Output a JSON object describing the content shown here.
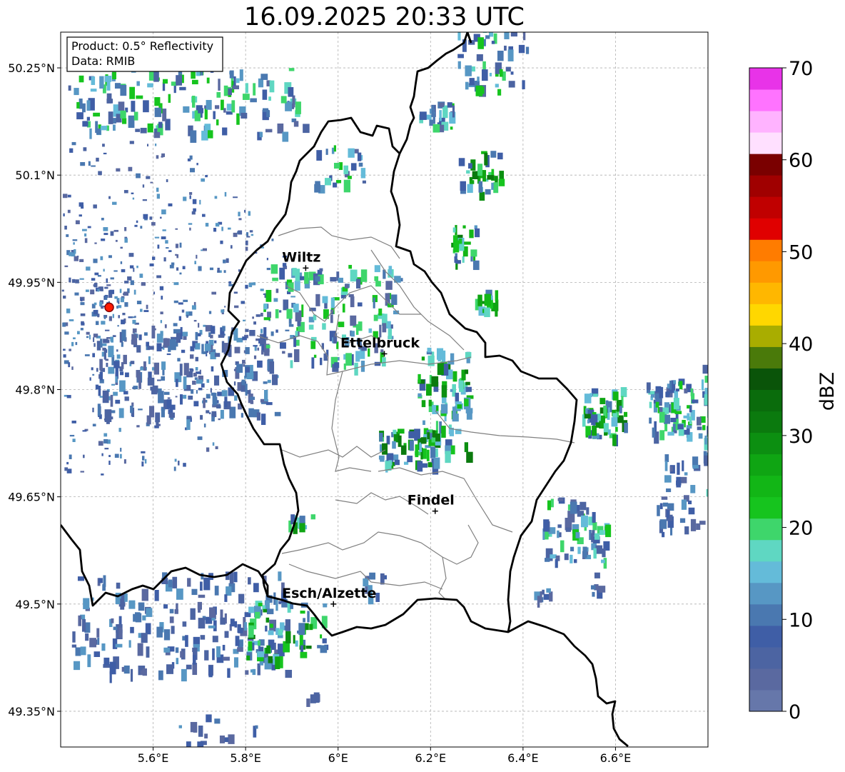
{
  "title": "16.09.2025 20:33 UTC",
  "info_box": {
    "product": "Product: 0.5° Reflectivity",
    "data": "Data: RMIB"
  },
  "lon_ticks": [
    {
      "value": 5.6,
      "label": "5.6°E"
    },
    {
      "value": 5.8,
      "label": "5.8°E"
    },
    {
      "value": 6.0,
      "label": "6°E"
    },
    {
      "value": 6.2,
      "label": "6.2°E"
    },
    {
      "value": 6.4,
      "label": "6.4°E"
    },
    {
      "value": 6.6,
      "label": "6.6°E"
    }
  ],
  "lat_ticks": [
    {
      "value": 50.25,
      "label": "50.25°N"
    },
    {
      "value": 50.1,
      "label": "50.1°N"
    },
    {
      "value": 49.95,
      "label": "49.95°N"
    },
    {
      "value": 49.8,
      "label": "49.8°N"
    },
    {
      "value": 49.65,
      "label": "49.65°N"
    },
    {
      "value": 49.5,
      "label": "49.5°N"
    },
    {
      "value": 49.35,
      "label": "49.35°N"
    }
  ],
  "extent": {
    "lon_min": 5.4,
    "lon_max": 6.8,
    "lat_min": 49.3,
    "lat_max": 50.3
  },
  "cities": [
    {
      "name": "Wiltz",
      "lon": 5.93,
      "lat": 49.97
    },
    {
      "name": "Ettelbruck",
      "lon": 6.1,
      "lat": 49.85
    },
    {
      "name": "Findel",
      "lon": 6.21,
      "lat": 49.63
    },
    {
      "name": "Esch/Alzette",
      "lon": 5.99,
      "lat": 49.5
    }
  ],
  "radar_site": {
    "lon": 5.505,
    "lat": 49.915,
    "color": "#ff1a00"
  },
  "colorbar": {
    "label": "dBZ",
    "min": 0,
    "max": 70,
    "ticks": [
      "0",
      "10",
      "20",
      "30",
      "40",
      "50",
      "60",
      "70"
    ],
    "colors": [
      "#6677aa",
      "#5a69a0",
      "#4c64a2",
      "#3f5ea6",
      "#4a78b0",
      "#5797c4",
      "#64bbd9",
      "#5fd7c2",
      "#3ed66b",
      "#16c41e",
      "#12b616",
      "#0fa513",
      "#0c8f11",
      "#0b7a0e",
      "#0a6c0c",
      "#0a5409",
      "#4a7a0a",
      "#a9ad00",
      "#ffd700",
      "#ffb700",
      "#ff9900",
      "#ff7c00",
      "#e00000",
      "#c00000",
      "#a00000",
      "#7a0000",
      "#ffe0ff",
      "#ffb3ff",
      "#ff73ff",
      "#e833e8"
    ]
  }
}
